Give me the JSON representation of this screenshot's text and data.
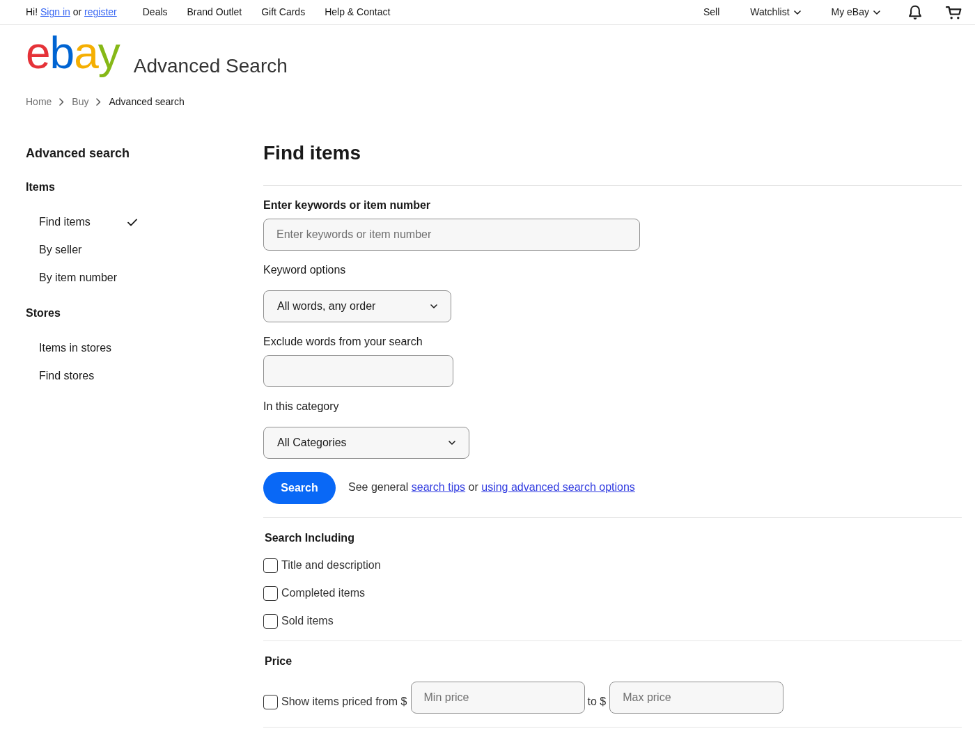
{
  "top_bar": {
    "greeting": {
      "hi": "Hi!",
      "sign_in": "Sign in",
      "or": "or",
      "register": "register"
    },
    "links": [
      "Deals",
      "Brand Outlet",
      "Gift Cards",
      "Help & Contact"
    ],
    "right_links": [
      {
        "label": "Sell",
        "dropdown": false
      },
      {
        "label": "Watchlist",
        "dropdown": true
      },
      {
        "label": "My eBay",
        "dropdown": true
      }
    ]
  },
  "header": {
    "logo": [
      {
        "letter": "e",
        "color": "#e53238"
      },
      {
        "letter": "b",
        "color": "#0064d2"
      },
      {
        "letter": "a",
        "color": "#f5af02"
      },
      {
        "letter": "y",
        "color": "#86b817"
      }
    ],
    "title": "Advanced Search"
  },
  "breadcrumb": [
    {
      "label": "Home",
      "current": false
    },
    {
      "label": "Buy",
      "current": false
    },
    {
      "label": "Advanced search",
      "current": true
    }
  ],
  "sidebar": {
    "title": "Advanced search",
    "groups": [
      {
        "heading": "Items",
        "items": [
          {
            "label": "Find items",
            "selected": true
          },
          {
            "label": "By seller",
            "selected": false
          },
          {
            "label": "By item number",
            "selected": false
          }
        ]
      },
      {
        "heading": "Stores",
        "items": [
          {
            "label": "Items in stores",
            "selected": false
          },
          {
            "label": "Find stores",
            "selected": false
          }
        ]
      }
    ]
  },
  "main": {
    "title": "Find items",
    "keywords": {
      "label": "Enter keywords or item number",
      "placeholder": "Enter keywords or item number"
    },
    "keyword_options": {
      "label": "Keyword options",
      "value": "All words, any order"
    },
    "exclude": {
      "label": "Exclude words from your search"
    },
    "category": {
      "label": "In this category",
      "value": "All Categories"
    },
    "search_button": "Search",
    "help": {
      "prefix": "See general",
      "link_1": "search tips",
      "middle": "or",
      "link_2": "using advanced search options"
    },
    "search_including": {
      "heading": "Search Including",
      "options": [
        {
          "label": "Title and description",
          "checked": false
        },
        {
          "label": "Completed items",
          "checked": false
        },
        {
          "label": "Sold items",
          "checked": false
        }
      ]
    },
    "price": {
      "heading": "Price",
      "label": "Show items priced from $",
      "checked": false,
      "min_placeholder": "Min price",
      "separator": "to $",
      "max_placeholder": "Max price"
    }
  }
}
